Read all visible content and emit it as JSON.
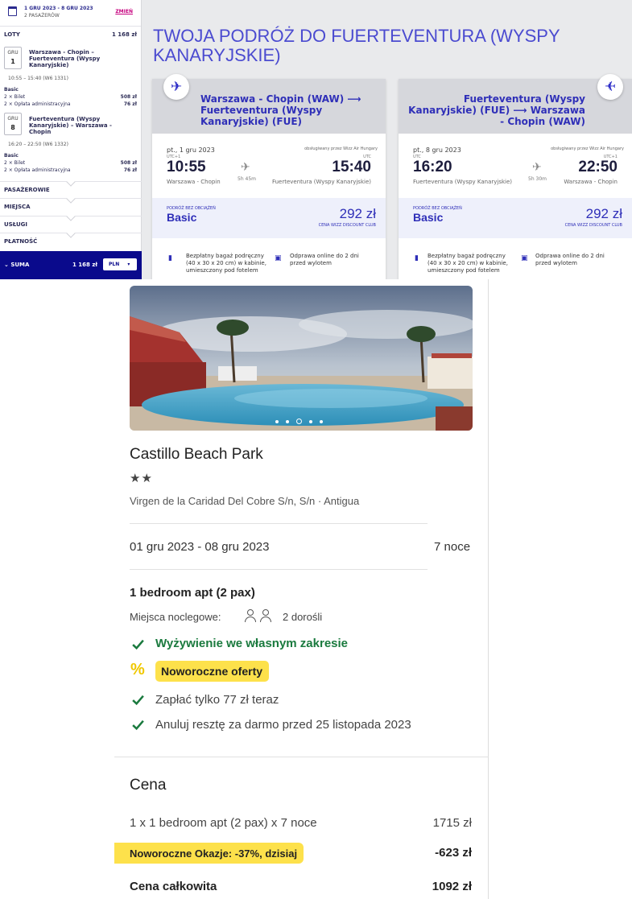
{
  "sidebar": {
    "dates": "1 GRU 2023 - 8 GRU 2023",
    "passengers": "2 PASAŻERÓW",
    "change_label": "ZMIEŃ",
    "flights_label": "LOTY",
    "flights_total": "1 168 zł",
    "outbound": {
      "month": "GRU",
      "day": "1",
      "route": "Warszawa - Chopin – Fuerteventura (Wyspy Kanaryjskie)",
      "time": "10:55 – 15:40 (W6 1331)",
      "fare": "Basic",
      "ticket": "2 × Bilet",
      "ticket_price": "508 zł",
      "fee": "2 × Opłata administracyjna",
      "fee_price": "76 zł"
    },
    "inbound": {
      "month": "GRU",
      "day": "8",
      "route": "Fuerteventura (Wyspy Kanaryjskie) – Warszawa - Chopin",
      "time": "16:20 – 22:50 (W6 1332)",
      "fare": "Basic",
      "ticket": "2 × Bilet",
      "ticket_price": "508 zł",
      "fee": "2 × Opłata administracyjna",
      "fee_price": "76 zł"
    },
    "sections": [
      "PASAŻEROWIE",
      "MIEJSCA",
      "USŁUGI",
      "PŁATNOŚĆ"
    ],
    "sum_label": "SUMA",
    "sum_value": "1 168 zł",
    "currency": "PLN"
  },
  "trip_title": "TWOJA PODRÓŻ DO FUERTEVENTURA (WYSPY KANARYJSKIE)",
  "flights": [
    {
      "route": "Warszawa - Chopin (WAW) ⟶ Fuerteventura (Wyspy Kanaryjskie) (FUE)",
      "date": "pt., 1 gru 2023",
      "operator": "obsługiwany przez Wizz Air Hungary",
      "dep_utc": "UTC+1",
      "arr_utc": "UTC",
      "dep_time": "10:55",
      "arr_time": "15:40",
      "duration": "5h 45m",
      "dep_airport": "Warszawa - Chopin",
      "arr_airport": "Fuerteventura (Wyspy Kanaryjskie)",
      "fare_label": "PODRÓŻ BEZ OBCIĄŻEŃ",
      "fare_name": "Basic",
      "fare_price": "292 zł",
      "fare_club": "CENA WIZZ DISCOUNT CLUB",
      "bag_info": "Bezpłatny bagaż podręczny (40 x 30 x 20 cm) w kabinie, umieszczony pod fotelem",
      "checkin_info": "Odprawa online do 2 dni przed wylotem"
    },
    {
      "route": "Fuerteventura (Wyspy Kanaryjskie) (FUE) ⟶ Warszawa - Chopin (WAW)",
      "date": "pt., 8 gru 2023",
      "operator": "obsługiwany przez Wizz Air Hungary",
      "dep_utc": "UTC",
      "arr_utc": "UTC+1",
      "dep_time": "16:20",
      "arr_time": "22:50",
      "duration": "5h 30m",
      "dep_airport": "Fuerteventura (Wyspy Kanaryjskie)",
      "arr_airport": "Warszawa - Chopin",
      "fare_label": "PODRÓŻ BEZ OBCIĄŻEŃ",
      "fare_name": "Basic",
      "fare_price": "292 zł",
      "fare_club": "CENA WIZZ DISCOUNT CLUB",
      "bag_info": "Bezpłatny bagaż podręczny (40 x 30 x 20 cm) w kabinie, umieszczony pod fotelem",
      "checkin_info": "Odprawa online do 2 dni przed wylotem"
    }
  ],
  "hotel": {
    "name": "Castillo Beach Park",
    "stars": "★★",
    "star_count": 2,
    "address": "Virgen de la Caridad Del Cobre S/n, S/n · Antigua",
    "dates": "01 gru 2023 - 08 gru 2023",
    "nights": "7 noce",
    "room": "1 bedroom apt (2 pax)",
    "beds_label": "Miejsca noclegowe:",
    "adults": "2 dorośli",
    "board": "Wyżywienie we własnym zakresie",
    "promo_badge": "Noworoczne oferty",
    "pay_now": "Zapłać tylko 77 zł teraz",
    "cancel": "Anuluj resztę za darmo przed 25 listopada 2023",
    "image_slide": 3,
    "image_slides": 5
  },
  "price": {
    "heading": "Cena",
    "line_label": "1 x 1 bedroom apt (2 pax) x 7 noce",
    "line_value": "1715 zł",
    "discount_label": "Noworoczne Okazje: -37%, dzisiaj",
    "discount_value": "-623 zł",
    "total_label": "Cena całkowita",
    "total_value": "1092 zł"
  },
  "colors": {
    "wizz_navy": "#0a0a8c",
    "wizz_blue": "#2f2fb8",
    "wizz_pink": "#c6007e",
    "check_green": "#1a7a3e",
    "promo_yellow": "#fde14b"
  }
}
